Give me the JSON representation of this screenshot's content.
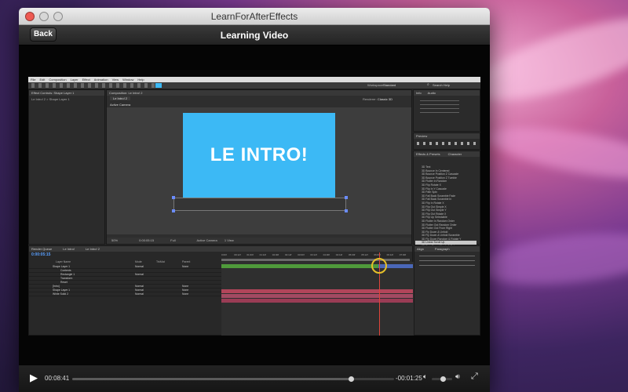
{
  "window": {
    "title": "LearnForAfterEffects"
  },
  "toolbar": {
    "back_label": "Back",
    "page_title": "Learning Video"
  },
  "ae": {
    "menu": [
      "File",
      "Edit",
      "Composition",
      "Layer",
      "Effect",
      "Animation",
      "View",
      "Window",
      "Help"
    ],
    "workspace_label": "Workspace:",
    "workspace_value": "Standard",
    "search_placeholder": "Search Help",
    "effect_controls_tab": "Effect Controls: Shape Layer 1",
    "comp_breadcrumb": "Le Intro! 2 > Shape Layer 1",
    "comp_tab": "Composition: Le Intro! 2",
    "comp_subtab": "Le Intro! 2",
    "camera_label": "Active Camera",
    "renderer": "Renderer:",
    "renderer_value": "Classic 3D",
    "info_tab": "Info",
    "audio_tab": "Audio",
    "preview_tab": "Preview",
    "effects_tab": "Effects & Presets",
    "character_tab": "Character",
    "paragraph_tab": "Paragraph",
    "align_tab": "Align",
    "comp_text": "LE INTRO!",
    "zoom": "50%",
    "view_res": "Full",
    "view_camera": "Active Camera",
    "view_count": "1 View",
    "timecode": "0:00:05:15",
    "timeline_tabs": [
      "Render Queue",
      "Le Intro!",
      "Le Intro! 2"
    ],
    "layer_header": "Layer Name",
    "mode_header": "Mode",
    "trkmat_header": "TrkMat",
    "parent_header": "Parent",
    "layers": [
      {
        "name": "Shape Layer 1",
        "mode": "Normal",
        "parent": "None"
      },
      {
        "name": "Contents",
        "mode": "",
        "parent": ""
      },
      {
        "name": "Rectangle 1",
        "mode": "Normal",
        "parent": ""
      },
      {
        "name": "Transform",
        "mode": "",
        "parent": ""
      },
      {
        "name": "Reset",
        "mode": "",
        "parent": ""
      },
      {
        "name": "[Intro]",
        "mode": "Normal",
        "parent": "None"
      },
      {
        "name": "Shape Layer 1",
        "mode": "Normal",
        "parent": "None"
      },
      {
        "name": "White Solid 2",
        "mode": "Normal",
        "parent": "None"
      }
    ],
    "ruler": [
      "0:00f",
      "00:12f",
      "01:00f",
      "01:12f",
      "02:00f",
      "02:12f",
      "03:00f",
      "03:12f",
      "04:00f",
      "04:12f",
      "05:00f",
      "05:12f",
      "06:00f",
      "06:12f",
      "07:00f"
    ],
    "presets": [
      "3D Text",
      "3D Bounce In Centered",
      "3D Bounce Position Z Cascade",
      "3D Bounce Position Z Tumble",
      "3D Flutter in Random",
      "3D Flip Rotate X",
      "3D Flip In Y Cascade",
      "3D Path Spin",
      "3D Fall Back Scramble Fade",
      "3D Fall Back Scramble In",
      "3D Flip In Rotate X",
      "3D Flip Out Simple X",
      "3D Flip Out Simple Y",
      "3D Flip Out Rotate X",
      "3D Flip Up Selectable",
      "3D Flutter In Random Order",
      "3D Flutter Out Random Order",
      "3D Flutter Out From Right",
      "3D Fly Down & Unfold",
      "3D Fly Down & Unfold Scramble",
      "3D Fly Down Random & Rotate Y",
      "3D Linear Scroll Up",
      "3D Rain Down Words & Colors",
      "3D Random Spin & Scroll",
      "3D Rotate Around Circle"
    ],
    "selected_preset_index": 21
  },
  "player": {
    "elapsed": "00:08:41",
    "remaining": "-00:01:25",
    "progress": 0.867,
    "volume": 0.55
  },
  "colors": {
    "accent": "#3cb9f5",
    "timeline_green": "#4f9a3b",
    "timeline_red": "#b2455a",
    "timeline_blue": "#4a67b8"
  }
}
